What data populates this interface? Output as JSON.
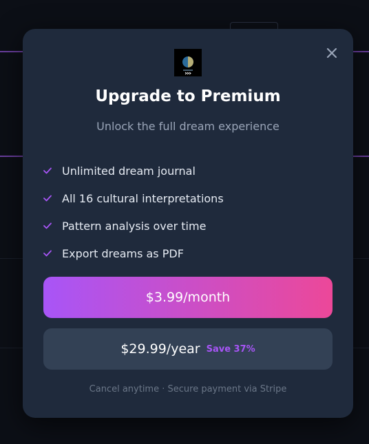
{
  "modal": {
    "title": "Upgrade to Premium",
    "subtitle": "Unlock the full dream experience",
    "close_icon": "close-icon",
    "logo_icon": "app-logo",
    "features": [
      {
        "label": "Unlimited dream journal",
        "icon": "check-icon"
      },
      {
        "label": "All 16 cultural interpretations",
        "icon": "check-icon"
      },
      {
        "label": "Pattern analysis over time",
        "icon": "check-icon"
      },
      {
        "label": "Export dreams as PDF",
        "icon": "check-icon"
      }
    ],
    "monthly_button": {
      "label": "$3.99/month"
    },
    "yearly_button": {
      "label": "$29.99/year",
      "badge": "Save 37%"
    },
    "footer": "Cancel anytime · Secure payment via Stripe"
  },
  "colors": {
    "accent_purple": "#a855f7",
    "accent_pink": "#ec4899",
    "modal_bg": "#1f2a3c",
    "backdrop": "#0c0f16"
  }
}
